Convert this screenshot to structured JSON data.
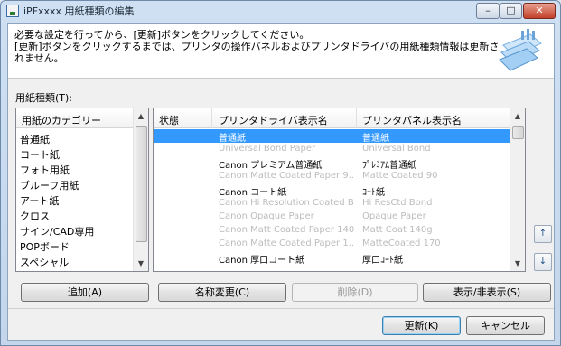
{
  "window": {
    "title": "iPFxxxx 用紙種類の編集",
    "controls": {
      "minimize": "–",
      "maximize": "□",
      "close": "✕"
    }
  },
  "message": {
    "line1": "必要な設定を行ってから、[更新]ボタンをクリックしてください。",
    "line2": "[更新]ボタンをクリックするまでは、プリンタの操作パネルおよびプリンタドライバの用紙種類情報は更新さ",
    "line3": "れません。"
  },
  "paper_type_label": "用紙種類(T):",
  "category": {
    "header": "用紙のカテゴリー",
    "items": [
      "普通紙",
      "コート紙",
      "フォト用紙",
      "ブルーフ用紙",
      "アート紙",
      "クロス",
      "サイン/CAD専用",
      "POPボード",
      "スペシャル"
    ]
  },
  "table": {
    "columns": [
      "状態",
      "プリンタドライバ表示名",
      "プリンタパネル表示名"
    ],
    "rows": [
      {
        "driver": "普通紙",
        "panel": "普通紙",
        "state": "selected"
      },
      {
        "driver": "Universal Bond Paper",
        "panel": "Universal Bond",
        "state": "dim"
      },
      {
        "driver": "Canon プレミアム普通紙",
        "panel": "ﾌﾟﾚﾐｱﾑ普通紙",
        "state": "normal"
      },
      {
        "driver": "Canon Matte Coated Paper 9...",
        "panel": "Matte Coated 90",
        "state": "dim"
      },
      {
        "driver": "Canon コート紙",
        "panel": "ｺｰﾄ紙",
        "state": "normal"
      },
      {
        "driver": "Canon Hi Resolution Coated B...",
        "panel": "Hi ResCtd Bond",
        "state": "dim"
      },
      {
        "driver": "Canon Opaque Paper",
        "panel": "Opaque Paper",
        "state": "dim"
      },
      {
        "driver": "Canon Matt Coated Paper 140g",
        "panel": "Matt Coat 140g",
        "state": "dim"
      },
      {
        "driver": "Canon Matte Coated Paper 1...",
        "panel": "MatteCoated 170",
        "state": "dim"
      },
      {
        "driver": "Canon 厚口コート紙",
        "panel": "厚口ｺｰﾄ紙",
        "state": "normal"
      }
    ]
  },
  "buttons": {
    "add": "追加(A)",
    "rename": "名称変更(C)",
    "delete": "削除(D)",
    "show_hide": "表示/非表示(S)",
    "update": "更新(K)",
    "cancel": "キャンセル"
  },
  "side_icons": {
    "move_up": "↑",
    "move_down": "↓"
  },
  "colors": {
    "selection": "#3399ff",
    "dim_text": "#bcbcbc"
  }
}
